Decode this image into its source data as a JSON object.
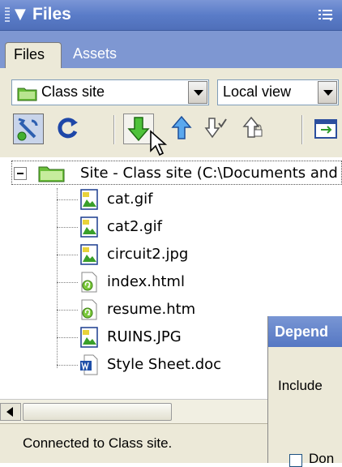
{
  "panel": {
    "title": "Files",
    "title_arrow": "▼",
    "options_icon": "panel-options-icon"
  },
  "tabs": [
    {
      "label": "Files",
      "active": true
    },
    {
      "label": "Assets",
      "active": false
    }
  ],
  "site_select": {
    "value": "Class site",
    "icon": "folder-icon"
  },
  "view_select": {
    "value": "Local view"
  },
  "toolbar": {
    "buttons": [
      {
        "icon": "connect-icon"
      },
      {
        "icon": "refresh-icon"
      },
      {
        "icon": "get-files-icon"
      },
      {
        "icon": "put-files-icon"
      },
      {
        "icon": "check-out-icon"
      },
      {
        "icon": "check-in-icon"
      },
      {
        "icon": "expand-icon"
      }
    ]
  },
  "tree": {
    "root": {
      "label": "Site - Class site (C:\\Documents and",
      "icon": "folder-icon"
    },
    "files": [
      {
        "name": "cat.gif",
        "icon": "image-file-icon"
      },
      {
        "name": "cat2.gif",
        "icon": "image-file-icon"
      },
      {
        "name": "circuit2.jpg",
        "icon": "image-file-icon"
      },
      {
        "name": "index.html",
        "icon": "html-file-icon"
      },
      {
        "name": "resume.htm",
        "icon": "html-file-icon"
      },
      {
        "name": "RUINS.JPG",
        "icon": "image-file-icon"
      },
      {
        "name": "Style Sheet.doc",
        "icon": "word-file-icon"
      }
    ]
  },
  "status": {
    "text": "Connected to Class site."
  },
  "dialog": {
    "title": "Depend",
    "include_label": "Include",
    "checkbox_label": "Don"
  }
}
